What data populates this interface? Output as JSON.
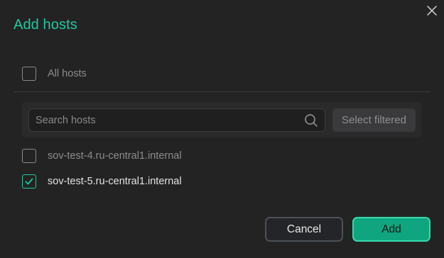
{
  "dialog": {
    "title": "Add hosts"
  },
  "all_hosts": {
    "label": "All hosts",
    "checked": false
  },
  "search": {
    "placeholder": "Search hosts",
    "value": "",
    "select_filtered_label": "Select filtered"
  },
  "hosts": [
    {
      "name": "sov-test-4.ru-central1.internal",
      "checked": false
    },
    {
      "name": "sov-test-5.ru-central1.internal",
      "checked": true
    }
  ],
  "actions": {
    "cancel_label": "Cancel",
    "add_label": "Add"
  },
  "colors": {
    "accent": "#1fc9a0",
    "primary_button": "#0fa57e",
    "background": "#232323"
  }
}
